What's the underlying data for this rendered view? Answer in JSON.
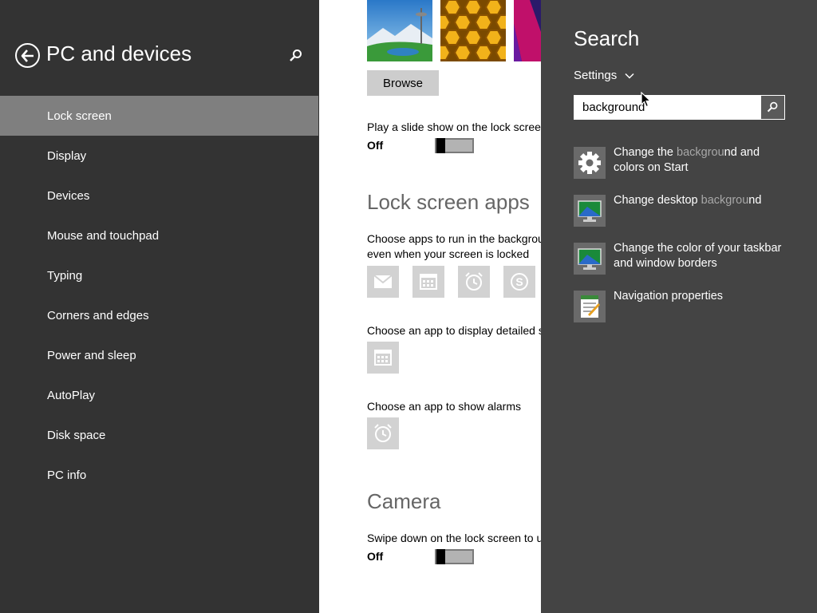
{
  "left_panel": {
    "title": "PC and devices",
    "nav_items": [
      {
        "label": "Lock screen",
        "selected": true
      },
      {
        "label": "Display"
      },
      {
        "label": "Devices"
      },
      {
        "label": "Mouse and touchpad"
      },
      {
        "label": "Typing"
      },
      {
        "label": "Corners and edges"
      },
      {
        "label": "Power and sleep"
      },
      {
        "label": "AutoPlay"
      },
      {
        "label": "Disk space"
      },
      {
        "label": "PC info"
      }
    ]
  },
  "content": {
    "browse_label": "Browse",
    "slideshow_label": "Play a slide show on the lock screen",
    "slideshow_state": "Off",
    "lock_apps_heading": "Lock screen apps",
    "choose_apps_line1": "Choose apps to run in the background and show quick status and notifications,",
    "choose_apps_line2": "even when your screen is locked",
    "detailed_label": "Choose an app to display detailed status",
    "alarms_label": "Choose an app to show alarms",
    "camera_heading": "Camera",
    "camera_label": "Swipe down on the lock screen to use the camera",
    "camera_state": "Off"
  },
  "search_charm": {
    "title": "Search",
    "scope": "Settings",
    "query": "background",
    "results": [
      {
        "pre": "Change the ",
        "hl": "backgrou",
        "post": "nd and",
        "line2": "colors on Start",
        "icon": "gear-icon"
      },
      {
        "pre": "Change desktop ",
        "hl": "backgrou",
        "post": "nd",
        "line2": "",
        "icon": "desktop-icon"
      },
      {
        "pre": "Change the color of your taskbar",
        "hl": "",
        "post": "",
        "line2": "and window borders",
        "icon": "desktop-icon"
      },
      {
        "pre": "Navigation properties",
        "hl": "",
        "post": "",
        "line2": "",
        "icon": "properties-icon"
      }
    ]
  },
  "colors": {
    "left_bg": "#333333",
    "selected_bg": "#7f7f7f",
    "charm_bg": "#444444",
    "highlight_text": "#a8a8a8"
  }
}
